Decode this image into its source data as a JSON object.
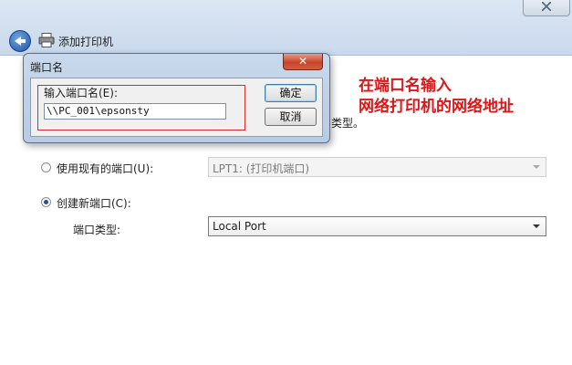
{
  "wizard": {
    "title": "添加打印机",
    "partial_text": "类型。"
  },
  "port_options": {
    "existing_label": "使用现有的端口(U):",
    "existing_value": "LPT1: (打印机端口)",
    "existing_checked": false,
    "new_label": "创建新端口(C):",
    "new_checked": true,
    "port_type_label": "端口类型:",
    "port_type_value": "Local Port"
  },
  "dialog": {
    "title": "端口名",
    "close_glyph": "✕",
    "field_label": "输入端口名(E):",
    "field_value": "\\\\PC_001\\epsonsty",
    "ok_label": "确定",
    "cancel_label": "取消"
  },
  "annotation": {
    "line1": "在端口名输入",
    "line2": "网络打印机的网络地址",
    "color": "#e01515"
  },
  "icons": {
    "back": "back-arrow-icon",
    "printer": "printer-icon",
    "window_close": "close-icon"
  }
}
